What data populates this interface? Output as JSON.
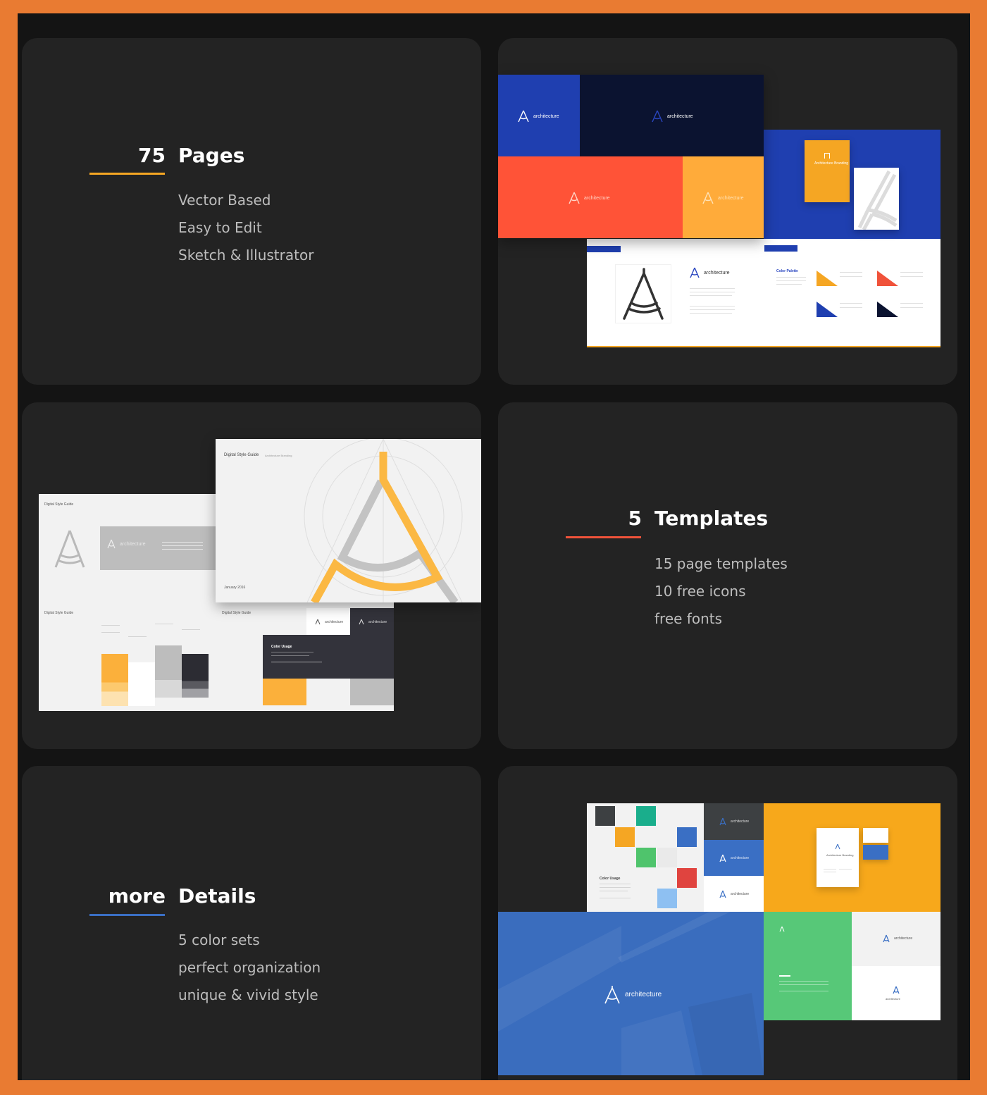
{
  "colors": {
    "frame_orange": "#e97b32",
    "background": "#141414",
    "card": "#232323",
    "accent_orange": "#f5a623",
    "accent_red": "#f0523a",
    "accent_blue": "#3a6fc4",
    "brand_blue": "#1f3fb0",
    "navy": "#0b1330",
    "yellow": "#fbb03b"
  },
  "features": [
    {
      "number": "75",
      "title": "Pages",
      "items": [
        "Vector Based",
        "Easy to Edit",
        "Sketch & Illustrator"
      ]
    },
    {
      "number": "5",
      "title": "Templates",
      "items": [
        "15 page templates",
        "10 free icons",
        "free fonts"
      ]
    },
    {
      "number": "more",
      "title": "Details",
      "items": [
        "5 color sets",
        "perfect organization",
        "unique & vivid style"
      ]
    }
  ],
  "preview": {
    "brand_name": "architecture",
    "style_guide_title": "Digital Style Guide",
    "style_guide_subtitle": "Architecture Branding",
    "date": "January 2016",
    "color_palette_title": "Color Palette",
    "color_usage_title": "Color Usage",
    "tab_label": "Architecture Branding",
    "branding_card_title": "Architecture Branding",
    "palette": [
      {
        "name": "Yellow",
        "hex": "#f5a623"
      },
      {
        "name": "Red",
        "hex": "#f0523a"
      },
      {
        "name": "Blue",
        "hex": "#1f3fb0"
      },
      {
        "name": "Dark Blue",
        "hex": "#0b1330"
      }
    ],
    "swatches": [
      {
        "name": "Yellow",
        "hex": "#fbb03b"
      },
      {
        "name": "White",
        "hex": "#ffffff"
      },
      {
        "name": "Grey",
        "hex": "#bdbdbd"
      },
      {
        "name": "Black",
        "hex": "#2c2c33"
      }
    ],
    "color_grid": [
      "#3d4042",
      "#1aae8c",
      "#f5a623",
      "#3a6fc4",
      "#4fc46c",
      "#eeeeee",
      "#e0443f",
      "#8ec0f2"
    ]
  }
}
